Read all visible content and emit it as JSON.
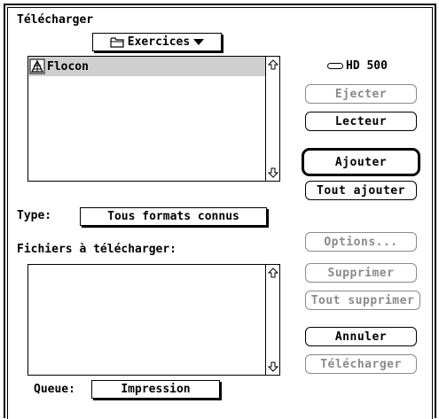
{
  "dialog": {
    "title": "Télécharger",
    "folder_popup": {
      "label": "Exercices",
      "icon": "folder-icon"
    },
    "file_list": {
      "items": [
        {
          "name": "Flocon",
          "icon": "application-icon",
          "selected": true
        }
      ]
    },
    "disk": {
      "icon": "hard-disk-icon",
      "label": "HD 500"
    },
    "buttons": {
      "eject": "Ejecter",
      "drive": "Lecteur",
      "add": "Ajouter",
      "add_all": "Tout ajouter",
      "options": "Options...",
      "remove": "Supprimer",
      "remove_all": "Tout supprimer",
      "cancel": "Annuler",
      "download": "Télécharger"
    },
    "type_label": "Type:",
    "type_popup": "Tous formats connus",
    "files_to_download_label": "Fichiers à télécharger:",
    "queue_label": "Queue:",
    "queue_popup": "Impression"
  }
}
